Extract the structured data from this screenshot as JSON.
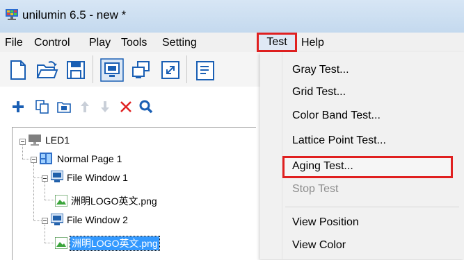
{
  "window": {
    "title": "unilumin 6.5 - new *"
  },
  "menubar": {
    "items": [
      {
        "label": "File"
      },
      {
        "label": "Control"
      },
      {
        "label": "Play"
      },
      {
        "label": "Tools"
      },
      {
        "label": "Setting"
      },
      {
        "label": "Test"
      },
      {
        "label": "Help"
      }
    ]
  },
  "test_menu": {
    "items": [
      {
        "label": "Gray Test..."
      },
      {
        "label": "Grid Test..."
      },
      {
        "label": "Color Band Test..."
      },
      {
        "label": "Lattice Point Test..."
      },
      {
        "label": "Aging Test..."
      },
      {
        "label": "Stop Test"
      },
      {
        "label": "View Position"
      },
      {
        "label": "View Color"
      }
    ]
  },
  "tree": {
    "screen": "LED1",
    "page": "Normal Page 1",
    "window1": "File Window 1",
    "file1": "洲明LOGO英文.png",
    "window2": "File Window 2",
    "file2": "洲明LOGO英文.png"
  },
  "colors": {
    "highlight_border": "#e02020",
    "selection": "#3399ff",
    "accent_blue": "#1a5fb4"
  }
}
